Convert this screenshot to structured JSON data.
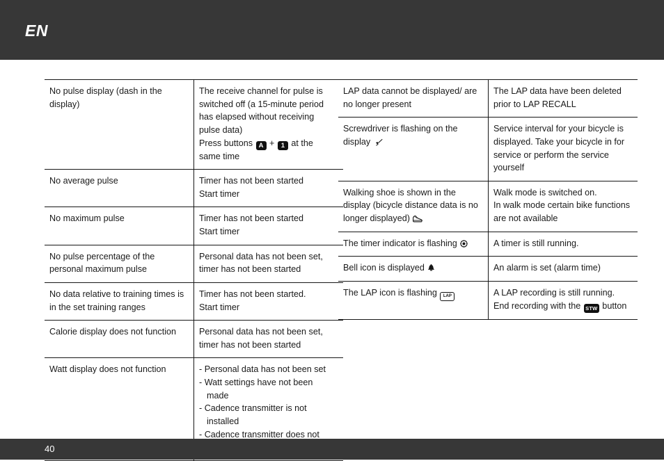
{
  "header": {
    "language": "EN"
  },
  "footer": {
    "page_number": "40"
  },
  "colors": {
    "bar_background": "#373737",
    "bar_text": "#ffffff",
    "page_background": "#ffffff",
    "rule": "#161616",
    "body_text": "#1a1a1a"
  },
  "left_table": {
    "rows": [
      {
        "problem": "No pulse display (dash in the display)",
        "cause_lines": [
          "The receive channel for pulse is switched off (a 15-minute period has elapsed without receiving pulse data)"
        ],
        "cause_press": {
          "prefix": "Press buttons ",
          "key1": "A",
          "plus": " + ",
          "key2": "1",
          "suffix": " at the same time"
        }
      },
      {
        "problem": "No average pulse",
        "cause_lines": [
          "Timer has not been started",
          "Start timer"
        ]
      },
      {
        "problem": "No maximum pulse",
        "cause_lines": [
          "Timer has not been started",
          "Start timer"
        ]
      },
      {
        "problem": "No pulse percentage of the personal maximum pulse",
        "cause_lines": [
          "Personal data has not been set, timer has not been started"
        ]
      },
      {
        "problem": "No data relative to training times is in the set training ranges",
        "cause_lines": [
          "Timer has not been started.",
          "Start timer"
        ]
      },
      {
        "problem": "Calorie display does not function",
        "cause_lines": [
          "Personal data has not been set, timer has not been started"
        ]
      },
      {
        "problem": "Watt display does not function",
        "cause_bullets": [
          "- Personal data has not been set",
          "- Watt settings have not been made",
          "- Cadence transmitter is not installed",
          "- Cadence transmitter does not function"
        ]
      }
    ]
  },
  "right_table": {
    "rows": [
      {
        "problem": "LAP data cannot be displayed/ are no longer present",
        "cause_lines": [
          "The LAP data have been deleted prior to LAP RECALL"
        ]
      },
      {
        "problem_prefix": "Screwdriver is flashing on the display ",
        "problem_icon": "screwdriver-icon",
        "cause_lines": [
          "Service interval for your bicycle is displayed. Take your bicycle in for service or perform the service yourself"
        ]
      },
      {
        "problem_prefix": "Walking shoe is shown in the display (bicycle distance data is no longer displayed) ",
        "problem_icon": "walking-shoe-icon",
        "cause_lines": [
          "Walk mode is switched on.",
          "In walk mode certain bike functions are not available"
        ]
      },
      {
        "problem_prefix": "The timer indicator is flashing ",
        "problem_icon": "timer-indicator-icon",
        "cause_lines": [
          "A timer is still running."
        ]
      },
      {
        "problem_prefix": "Bell icon is displayed ",
        "problem_icon": "bell-icon",
        "cause_lines": [
          "An alarm is set (alarm time)"
        ]
      },
      {
        "problem_prefix": "The LAP icon is flashing ",
        "problem_icon": "lap-icon",
        "problem_icon_label": "LAP",
        "cause_prefix": "A LAP recording is still running. End recording with the ",
        "cause_key": "STW",
        "cause_suffix": " button"
      }
    ]
  }
}
